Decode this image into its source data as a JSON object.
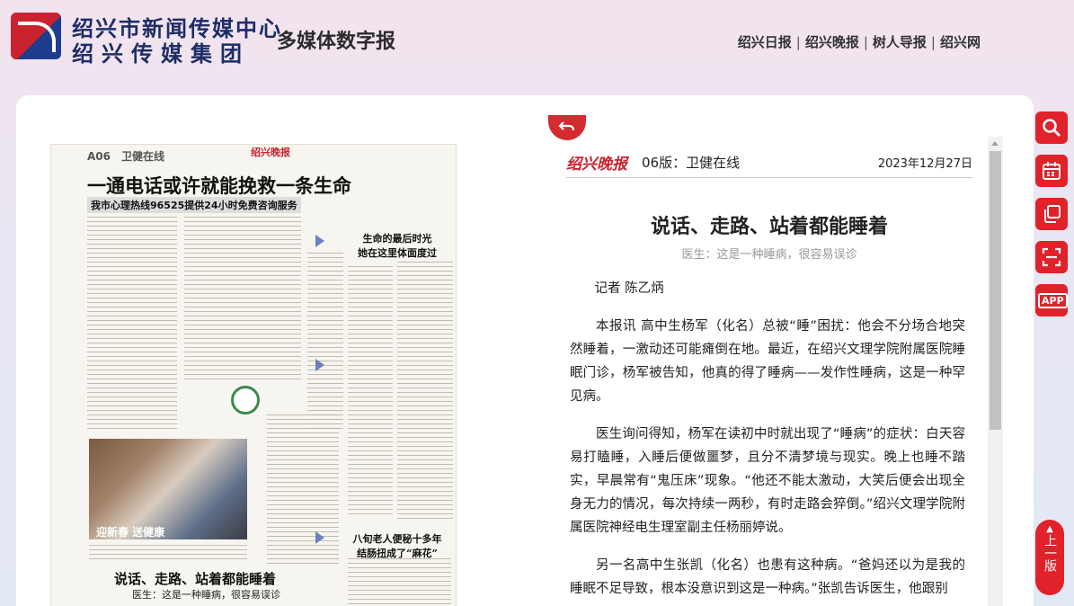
{
  "header": {
    "logo_line1": "绍兴市新闻传媒中心",
    "logo_line2": "绍兴传媒集团",
    "site_title": "多媒体数字报",
    "nav": [
      "绍兴日报",
      "绍兴晚报",
      "树人导报",
      "绍兴网"
    ]
  },
  "newspaper": {
    "page_label": "A06",
    "section": "卫健在线",
    "brand": "绍兴晚报",
    "headline": "一通电话或许就能挽救一条生命",
    "subheadline": "我市心理热线96525提供24小时免费咨询服务",
    "side_headline_1": "生命的最后时光\n她在这里体面度过",
    "photo_caption": "迎新春 送健康",
    "bottom_headline": "说话、走路、站着都能睡着",
    "bottom_subheadline": "医生：这是一种睡病，很容易误诊",
    "side_headline_2": "八旬老人便秘十多年\n结肠扭成了“麻花”"
  },
  "article": {
    "brand": "绍兴晚报",
    "edition": "06版：卫健在线",
    "date": "2023年12月27日",
    "title": "说话、走路、站着都能睡着",
    "subtitle": "医生：这是一种睡病，很容易误诊",
    "byline": "记者 陈乙炳",
    "paragraphs": [
      "本报讯 高中生杨军（化名）总被“睡”困扰：他会不分场合地突然睡着，一激动还可能瘫倒在地。最近，在绍兴文理学院附属医院睡眠门诊，杨军被告知，他真的得了睡病——发作性睡病，这是一种罕见病。",
      "医生询问得知，杨军在读初中时就出现了“睡病”的症状：白天容易打瞌睡，入睡后便做噩梦，且分不清梦境与现实。晚上也睡不踏实，早晨常有“鬼压床”现象。“他还不能太激动，大笑后便会出现全身无力的情况，每次持续一两秒，有时走路会猝倒。”绍兴文理学院附属医院神经电生理室副主任杨丽婷说。",
      "另一名高中生张凯（化名）也患有这种病。“爸妈还以为是我的睡眠不足导致，根本没意识到这是一种病。”张凯告诉医生，他跟别"
    ]
  },
  "tools": [
    "search-icon",
    "calendar-icon",
    "copy-icon",
    "scan-icon",
    "app-icon"
  ],
  "tools_app_label": "APP",
  "prev_page": "上一版",
  "colors": {
    "accent": "#e0222a",
    "brand_blue": "#1d2d66"
  }
}
